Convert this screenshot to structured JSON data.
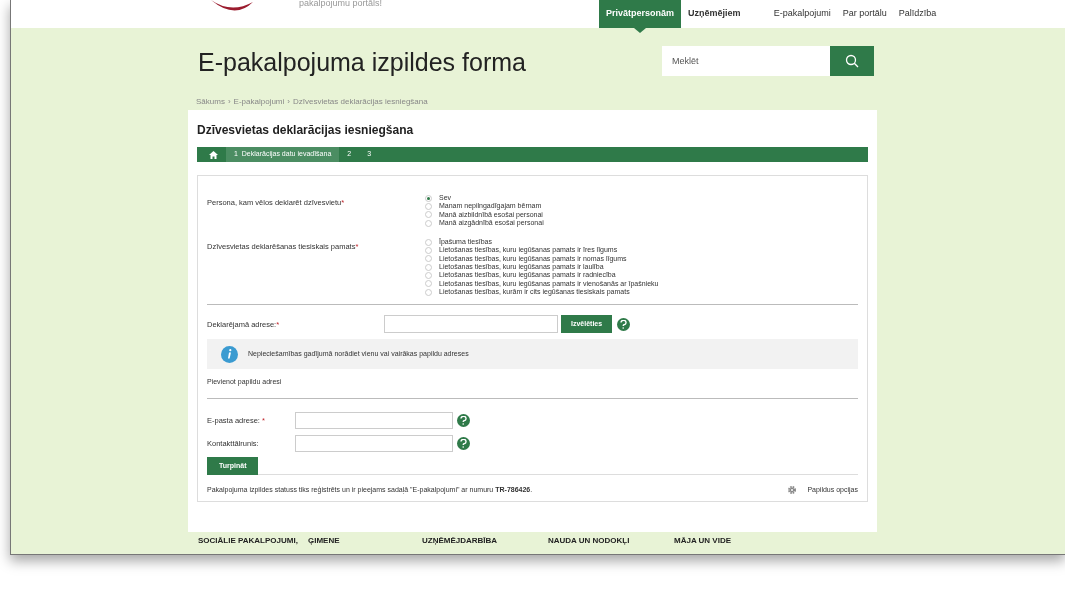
{
  "header": {
    "tagline": "pakalpojumu portāls!",
    "nav": [
      {
        "label": "Privātpersonām",
        "kind": "audience",
        "selected": true
      },
      {
        "label": "Uzņēmējiem",
        "kind": "audience",
        "selected": false
      },
      {
        "label": "E-pakalpojumi",
        "kind": "link",
        "selected": false
      },
      {
        "label": "Par portālu",
        "kind": "link",
        "selected": false
      },
      {
        "label": "Palīdzība",
        "kind": "link",
        "selected": false
      }
    ]
  },
  "page_title": "E-pakalpojuma izpildes forma",
  "search": {
    "placeholder": "Meklēt"
  },
  "breadcrumbs": [
    {
      "label": "Sākums"
    },
    {
      "separator": "›",
      "label": "E-pakalpojumi"
    },
    {
      "separator": "›",
      "label": "Dzīvesvietas deklarācijas iesniegšana"
    }
  ],
  "form": {
    "title": "Dzīvesvietas deklarācijas iesniegšana",
    "steps": [
      {
        "number": "1",
        "label": "Deklarācijas datu ievadīšana",
        "selected": true
      },
      {
        "number": "2",
        "selected": false
      },
      {
        "number": "3",
        "selected": false
      }
    ],
    "radio_groups": [
      {
        "label": "Persona, kam vēlos deklarēt dzīvesvietu",
        "mark": "*",
        "options": [
          {
            "label": "Sev",
            "selected": true
          },
          {
            "label": "Manam nepilngadīgajam bērnam",
            "selected": false
          },
          {
            "label": "Manā aizbildnībā esošai personai",
            "selected": false
          },
          {
            "label": "Manā aizgādnībā esošai personai",
            "selected": false
          }
        ]
      },
      {
        "label": "Dzīvesvietas deklarēšanas tiesiskais pamats",
        "mark": "*",
        "options": [
          {
            "label": "Īpašuma tiesības",
            "selected": false
          },
          {
            "label": "Lietošanas tiesības, kuru iegūšanas pamats ir īres līgums",
            "selected": false
          },
          {
            "label": "Lietošanas tiesības, kuru iegūšanas pamats ir nomas līgums",
            "selected": false
          },
          {
            "label": "Lietošanas tiesības, kuru iegūšanas pamats ir laulība",
            "selected": false
          },
          {
            "label": "Lietošanas tiesības, kuru iegūšanas pamats ir radniecība",
            "selected": false
          },
          {
            "label": "Lietošanas tiesības, kuru iegūšanas pamats ir vienošanās ar īpašnieku",
            "selected": false
          },
          {
            "label": "Lietošanas tiesības, kurām ir cits iegūšanas tiesiskais pamats",
            "selected": false
          }
        ]
      }
    ],
    "address": {
      "label": "Deklarējamā adrese:",
      "mark": "*",
      "button": "Izvēlēties"
    },
    "info": "Nepieciešamības gadījumā norādiet vienu vai vairākas papildu adreses",
    "add_address": "Pievienot papildu adresi",
    "contacts": [
      {
        "label": "E-pasta adrese: ",
        "mark": "*"
      },
      {
        "label": "Kontakttālrunis:"
      }
    ],
    "submit": "Turpināt",
    "status": "Pakalpojuma izpildes statuss tiks reģistrēts un ir pieejams sadaļā \"E-pakalpojumi\" ar numuru **TR-786426**.",
    "options_link": "Papildus opcijas"
  },
  "footer_categories": [
    "SOCIĀLIE PAKALPOJUMI,",
    "ĢIMENE",
    "UZŅĒMĒJDARBĪBA",
    "NAUDA UN NODOKĻI",
    "MĀJA UN VIDE"
  ]
}
